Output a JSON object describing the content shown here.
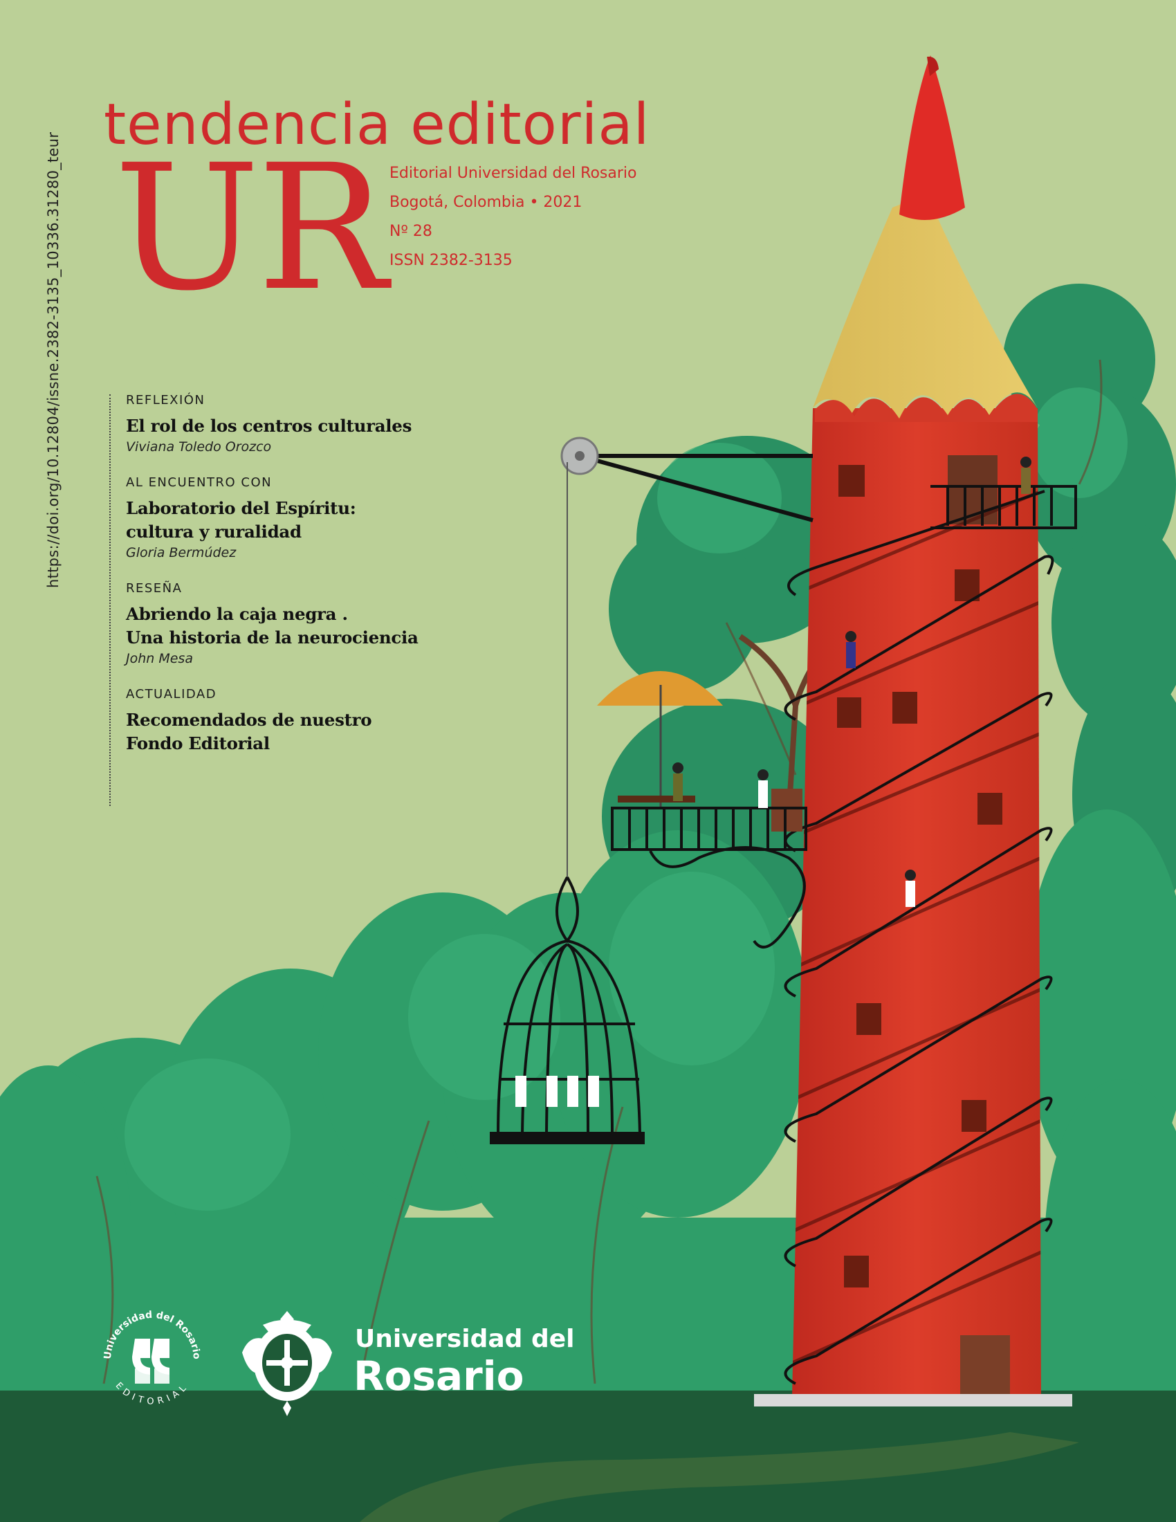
{
  "masthead": {
    "title": "tendencia editorial",
    "mark": "UR",
    "publisher": "Editorial Universidad del Rosario",
    "place_year": "Bogotá, Colombia • 2021",
    "issue": "Nº 28",
    "issn": "ISSN 2382-3135"
  },
  "doi": "https://doi.org/10.12804/issne.2382-3135_10336.31280_teur",
  "toc": [
    {
      "section": "REFLEXIÓN",
      "title": [
        "El rol de los centros culturales"
      ],
      "author": "Viviana Toledo Orozco"
    },
    {
      "section": "AL ENCUENTRO CON",
      "title": [
        "Laboratorio del Espíritu:",
        "cultura y ruralidad"
      ],
      "author": "Gloria Bermúdez"
    },
    {
      "section": "RESEÑA",
      "title": [
        "Abriendo la caja negra .",
        "Una historia de la neurociencia"
      ],
      "author": "John Mesa"
    },
    {
      "section": "ACTUALIDAD",
      "title": [
        "Recomendados de nuestro",
        "Fondo Editorial"
      ],
      "author": ""
    }
  ],
  "logos": {
    "seal_ring": "Universidad del Rosario",
    "seal_bottom": "EDITORIAL",
    "university_line1": "Universidad del",
    "university_line2": "Rosario"
  },
  "colors": {
    "background": "#bbd097",
    "brand_red": "#cf2a2c",
    "tree_green": "#2e9a66",
    "tower_red": "#d93a2a"
  }
}
